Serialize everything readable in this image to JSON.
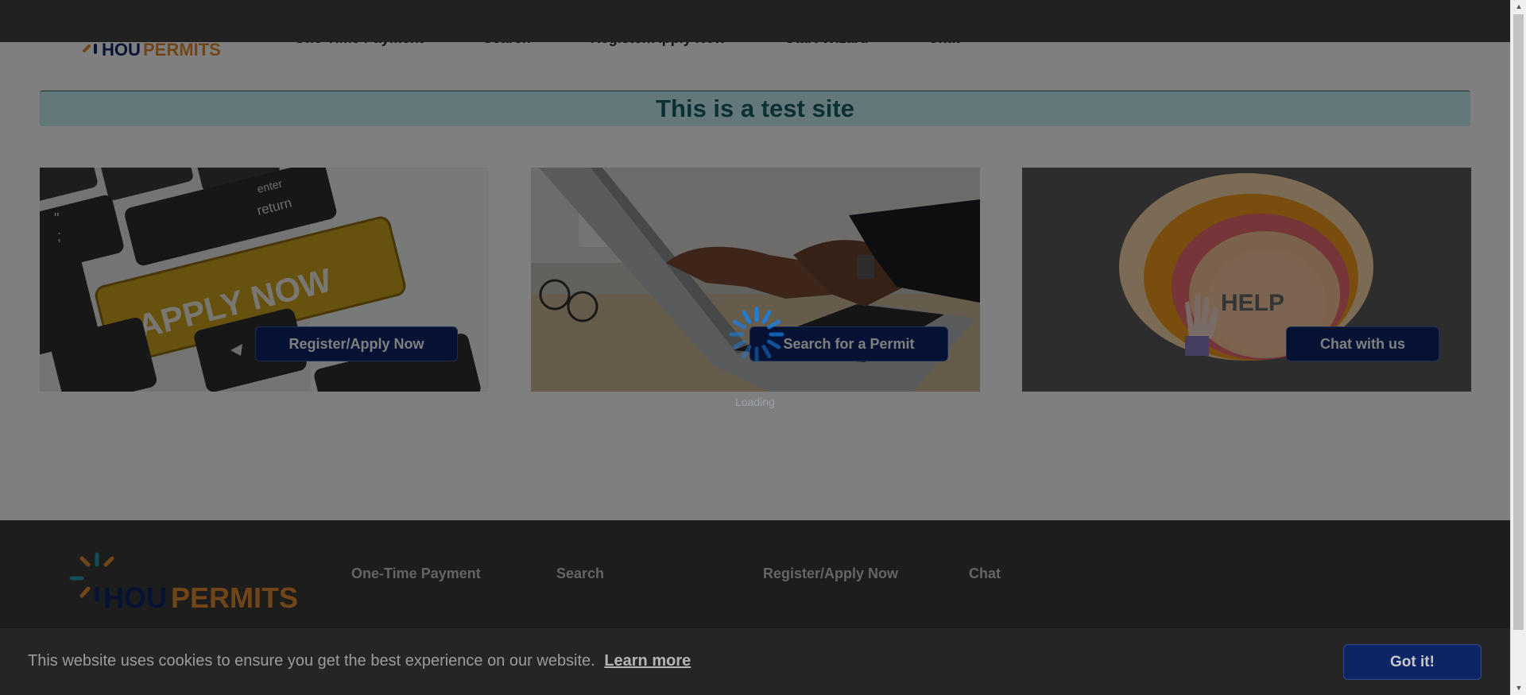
{
  "header": {
    "logo_alt": "HOUPERMITS",
    "nav": [
      "One-Time Payment",
      "Search",
      "Register/Apply Now",
      "Start Wizard",
      "Chat"
    ]
  },
  "banner": {
    "text": "This is a test site"
  },
  "cards": [
    {
      "image": "apply-now-keyboard",
      "image_text": "APPLY NOW",
      "button": "Register/Apply Now"
    },
    {
      "image": "laptop-typing",
      "button": "Search for a Permit"
    },
    {
      "image": "help-concentric-circles",
      "image_text": "HELP",
      "button": "Chat with us"
    }
  ],
  "loading": {
    "text": "Loading"
  },
  "footer": {
    "logo_alt": "HOUPERMITS",
    "nav": [
      "One-Time Payment",
      "Search",
      "Register/Apply Now",
      "Chat"
    ]
  },
  "cookie": {
    "message": "This website uses cookies to ensure you get the best experience on our website.",
    "learn_more": "Learn more",
    "button": "Got it!"
  },
  "colors": {
    "brand_navy": "#0b2566",
    "brand_orange": "#e08a2e",
    "banner_bg": "#c9f0f5",
    "banner_text": "#175e66",
    "footer_bg": "#3a3a3a"
  }
}
